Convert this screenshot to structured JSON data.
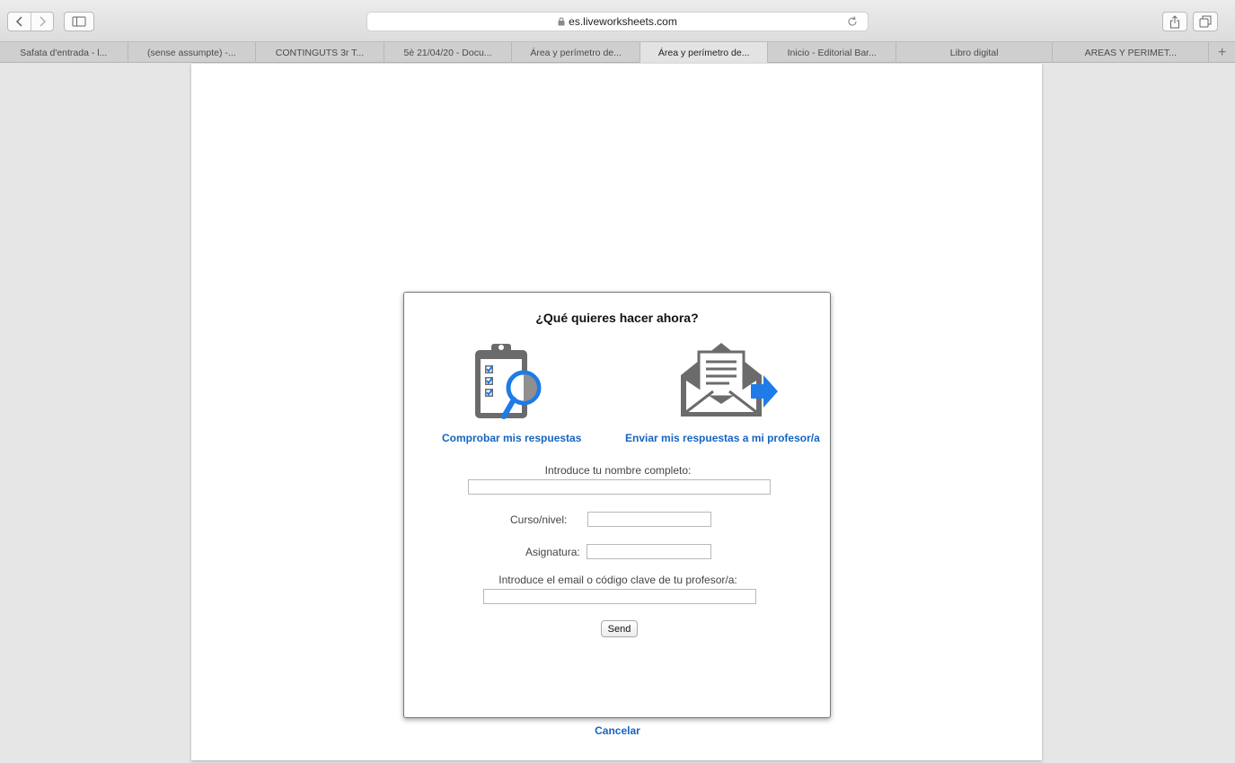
{
  "browser": {
    "url": "es.liveworksheets.com",
    "tabs": [
      {
        "label": "Safata d'entrada - l...",
        "active": false
      },
      {
        "label": "(sense assumpte) -...",
        "active": false
      },
      {
        "label": "CONTINGUTS 3r T...",
        "active": false
      },
      {
        "label": "5è 21/04/20 - Docu...",
        "active": false
      },
      {
        "label": "Área y perímetro de...",
        "active": false
      },
      {
        "label": "Área y perímetro de...",
        "active": true
      },
      {
        "label": "Inicio - Editorial Bar...",
        "active": false
      },
      {
        "label": "Libro digital",
        "active": false
      },
      {
        "label": "AREAS Y PERIMET...",
        "active": false
      }
    ],
    "new_tab_label": "+"
  },
  "dialog": {
    "title": "¿Qué quieres hacer ahora?",
    "check_label": "Comprobar mis respuestas",
    "send_label": "Enviar mis respuestas a mi profesor/a",
    "name_label": "Introduce tu nombre completo:",
    "course_label": "Curso/nivel:",
    "subject_label": "Asignatura:",
    "email_label": "Introduce el email o código clave de tu profesor/a:",
    "send_button": "Send",
    "name_value": "",
    "course_value": "",
    "subject_value": "",
    "email_value": ""
  },
  "cancel_label": "Cancelar",
  "colors": {
    "link": "#1565c0",
    "icon_gray": "#6b6b6b",
    "icon_blue": "#1e7be8"
  }
}
